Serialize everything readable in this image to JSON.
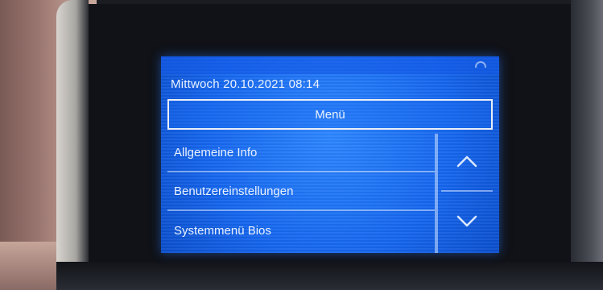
{
  "header": {
    "datetime": "Mittwoch 20.10.2021 08:14",
    "title": "Menü"
  },
  "menu": {
    "items": [
      {
        "label": "Allgemeine Info"
      },
      {
        "label": "Benutzereinstellungen"
      },
      {
        "label": "Systemmenü Bios"
      }
    ]
  },
  "icons": {
    "up": "chevron-up-icon",
    "down": "chevron-down-icon",
    "wifi": "wifi-icon"
  },
  "colors": {
    "screen": "#1565e6",
    "text": "#eaf2ff",
    "border": "#e9eef8"
  }
}
